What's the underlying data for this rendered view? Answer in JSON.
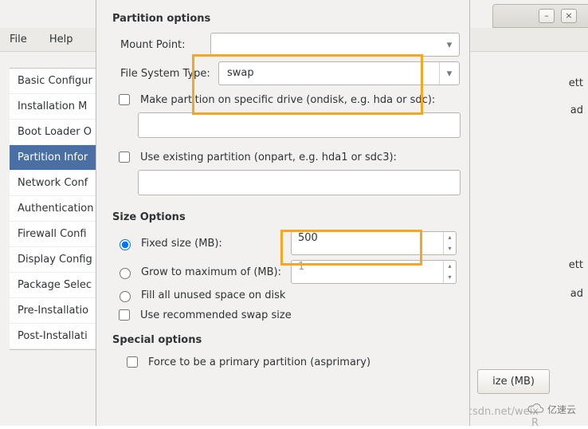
{
  "window": {
    "minimize": "–",
    "close": "×"
  },
  "menu": {
    "file": "File",
    "help": "Help"
  },
  "sidebar": {
    "items": [
      {
        "label": "Basic Configur"
      },
      {
        "label": "Installation M"
      },
      {
        "label": "Boot Loader O"
      },
      {
        "label": "Partition Infor"
      },
      {
        "label": "Network Conf"
      },
      {
        "label": "Authentication"
      },
      {
        "label": "Firewall Confi"
      },
      {
        "label": "Display Config"
      },
      {
        "label": "Package Selec"
      },
      {
        "label": "Pre-Installatio"
      },
      {
        "label": "Post-Installati"
      }
    ],
    "selected_index": 3
  },
  "background": {
    "frag1": "ett",
    "frag2": "ad",
    "frag3": "ett",
    "frag4": "ad",
    "col_header": "ize (MB)"
  },
  "dialog": {
    "partition_title": "Partition options",
    "mount_point_label": "Mount Point:",
    "mount_point_value": "",
    "fs_type_label": "File System Type:",
    "fs_type_value": "swap",
    "ondisk_label": "Make partition on specific drive (ondisk, e.g. hda or sdc):",
    "ondisk_value": "",
    "onpart_label": "Use existing partition (onpart, e.g. hda1 or sdc3):",
    "onpart_value": "",
    "size_title": "Size Options",
    "fixed_label": "Fixed size (MB):",
    "fixed_value": "500",
    "grow_label": "Grow to maximum of (MB):",
    "grow_value": "1",
    "fill_label": "Fill all unused space on disk",
    "recommended_label": "Use recommended swap size",
    "special_title": "Special options",
    "asprimary_label": "Force to be a primary partition (asprimary)"
  },
  "watermark": "https://blog.csdn.net/weix",
  "logo_text": "亿速云"
}
